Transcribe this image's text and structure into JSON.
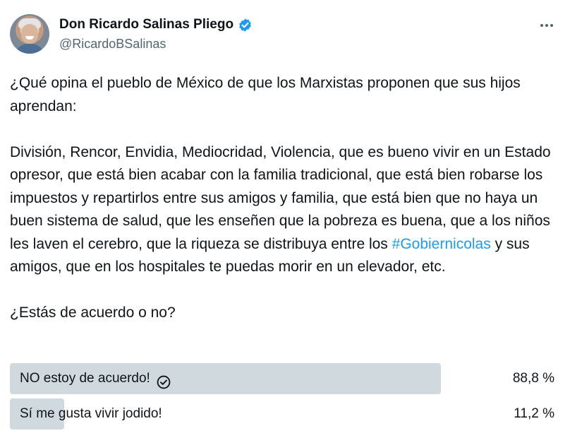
{
  "author": {
    "display_name": "Don Ricardo Salinas Pliego",
    "handle": "@RicardoBSalinas"
  },
  "tweet": {
    "paragraph1": "¿Qué opina el pueblo de México de que los Marxistas proponen que sus hijos aprendan:",
    "paragraph2_before": "División, Rencor, Envidia, Mediocridad, Violencia, que es bueno vivir en un Estado opresor, que está bien acabar con la familia tradicional, que está bien robarse los impuestos y repartirlos entre sus amigos y familia, que está bien que no haya un buen sistema de salud, que les enseñen que la pobreza es buena, que a los niños les laven el cerebro, que la riqueza se distribuya entre los ",
    "hashtag": "#Gobiernicolas",
    "paragraph2_after": " y sus amigos, que en los hospitales te puedas morir en un elevador, etc.",
    "question": "¿Estás de acuerdo o no?"
  },
  "poll": {
    "options": [
      {
        "label": "NO estoy de acuerdo!",
        "percent_text": "88,8 %",
        "percent": 88.8,
        "selected": true
      },
      {
        "label": "Sí me gusta vivir jodido!",
        "percent_text": "11,2 %",
        "percent": 11.2,
        "selected": false
      }
    ]
  },
  "colors": {
    "text": "#0f1419",
    "muted": "#536471",
    "link": "#1d9bf0",
    "verified": "#1d9bf0",
    "poll_bar": "#cfd9de"
  },
  "icons": {
    "verified": "verified-badge-icon",
    "more": "more-options-icon",
    "selected": "check-circle-icon"
  }
}
